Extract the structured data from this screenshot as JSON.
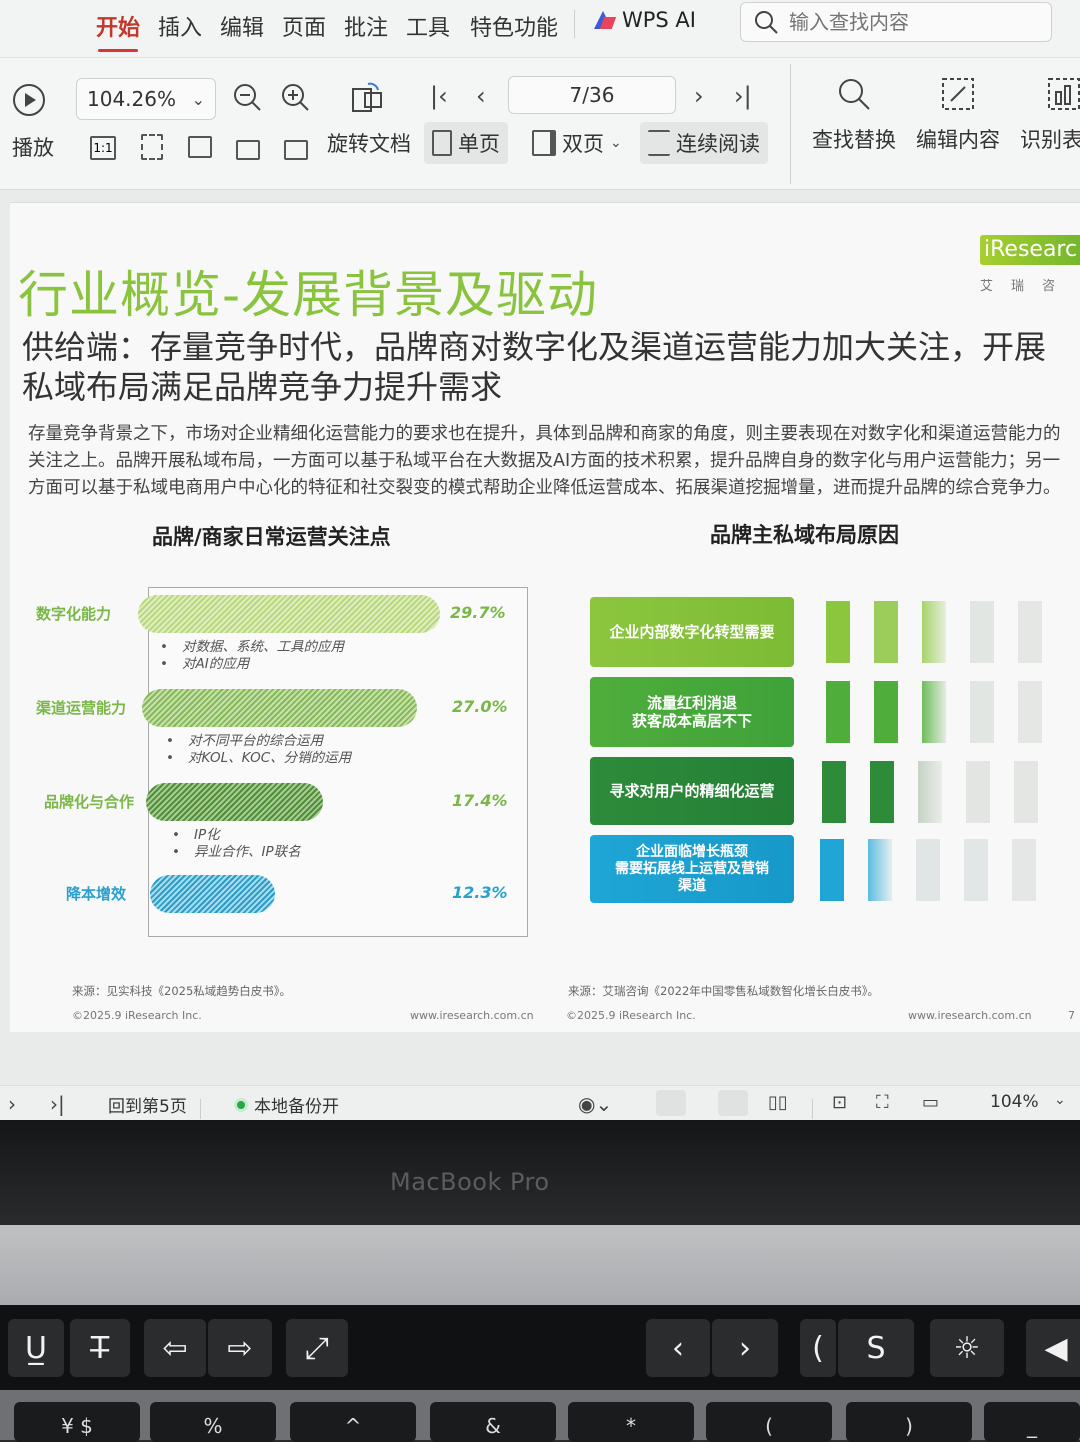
{
  "menu": {
    "tabs": [
      "开始",
      "插入",
      "编辑",
      "页面",
      "批注",
      "工具",
      "特色功能"
    ],
    "wps_ai": "WPS AI",
    "search_placeholder": "输入查找内容"
  },
  "toolbar": {
    "zoom": "104.26%",
    "play": "播放",
    "page_indicator": "7/36",
    "rotate": "旋转文档",
    "single_page": "单页",
    "double_page": "双页",
    "continuous": "连续阅读",
    "find_replace": "查找替换",
    "edit_content": "编辑内容",
    "recognize_table": "识别表"
  },
  "document": {
    "brand": "iResearc",
    "brand_sub": "艾瑞咨",
    "title": "行业概览-发展背景及驱动",
    "subtitle": "供给端：存量竞争时代，品牌商对数字化及渠道运营能力加大关注，开展私域布局满足品牌竞争力提升需求",
    "body": "存量竞争背景之下，市场对企业精细化运营能力的要求也在提升，具体到品牌和商家的角度，则主要表现在对数字化和渠道运营能力的关注之上。品牌开展私域布局，一方面可以基于私域平台在大数据及AI方面的技术积累，提升品牌自身的数字化与用户运营能力；另一方面可以基于私域电商用户中心化的特征和社交裂变的模式帮助企业降低运营成本、拓展渠道挖掘增量，进而提升品牌的综合竞争力。",
    "left_chart": {
      "title": "品牌/商家日常运营关注点",
      "source": "来源：见实科技《2025私域趋势白皮书》。",
      "copyright": "©2025.9 iResearch Inc.",
      "website": "www.iresearch.com.cn"
    },
    "right_chart": {
      "title": "品牌主私域布局原因",
      "reasons": [
        "企业内部数字化转型需要",
        "流量红利消退\n获客成本高居不下",
        "寻求对用户的精细化运营",
        "企业面临增长瓶颈\n需要拓展线上运营及营销\n渠道"
      ],
      "source": "来源：艾瑞咨询《2022年中国零售私域数智化增长白皮书》。",
      "copyright": "©2025.9 iResearch Inc.",
      "website": "www.iresearch.com.cn",
      "page_no": "7"
    }
  },
  "chart_data": {
    "type": "bar",
    "orientation": "horizontal",
    "title": "品牌/商家日常运营关注点",
    "categories": [
      "数字化能力",
      "渠道运营能力",
      "品牌化与合作",
      "降本增效"
    ],
    "values": [
      29.7,
      27.0,
      17.4,
      12.3
    ],
    "value_labels": [
      "29.7%",
      "27.0%",
      "17.4%",
      "12.3%"
    ],
    "notes": [
      [
        "对数据、系统、工具的应用",
        "对AI的应用"
      ],
      [
        "对不同平台的综合运用",
        "对KOL、KOC、分销的运用"
      ],
      [
        "IP化",
        "异业合作、IP联名"
      ],
      []
    ],
    "colors": [
      "#b9d77c",
      "#86b95a",
      "#4f8f3a",
      "#2c9ec6"
    ]
  },
  "statusbar": {
    "back_to": "回到第5页",
    "backup": "本地备份开",
    "zoom": "104%"
  },
  "laptop": {
    "label": "MacBook Pro"
  }
}
